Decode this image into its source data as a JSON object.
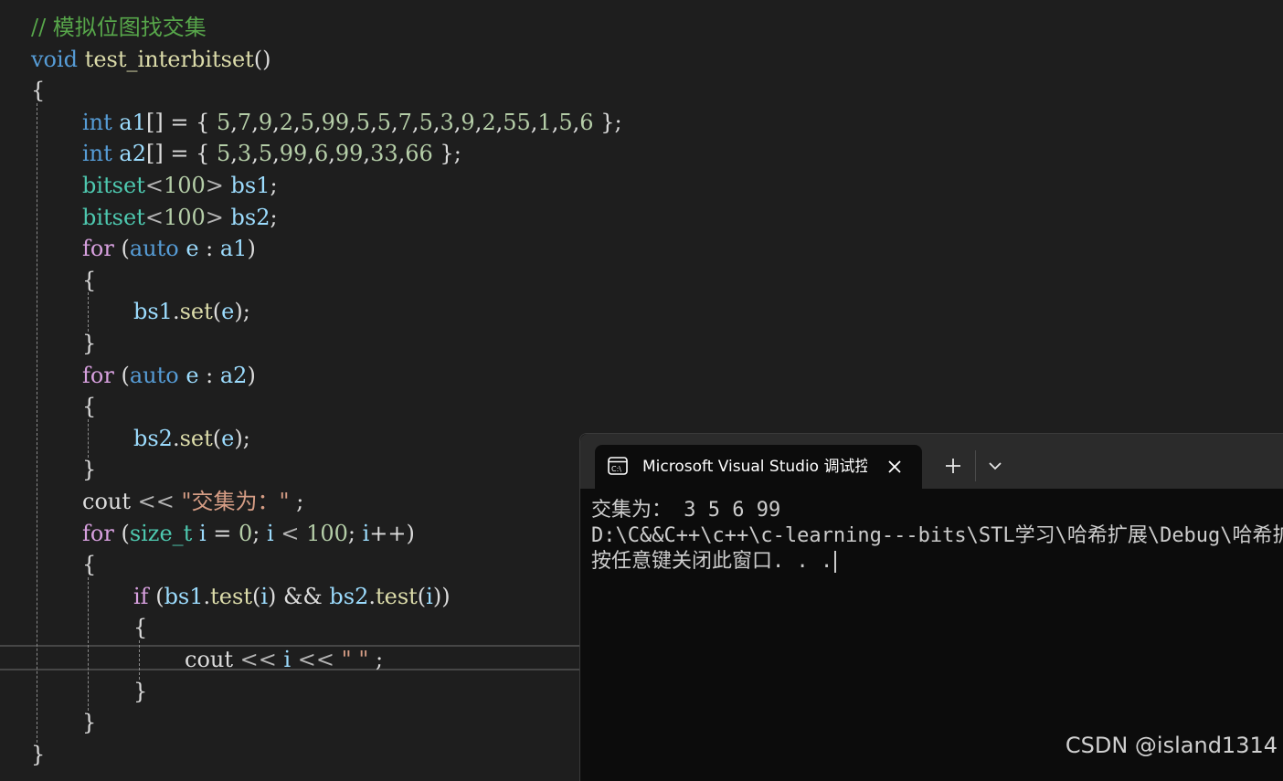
{
  "editor": {
    "lines": [
      [
        {
          "t": "// 模拟位图找交集",
          "c": "cmt"
        }
      ],
      [
        {
          "t": "void",
          "c": "kw"
        },
        {
          "t": " ",
          "c": "punc"
        },
        {
          "t": "test_interbitset",
          "c": "fn"
        },
        {
          "t": "()",
          "c": "punc"
        }
      ],
      [
        {
          "t": "{",
          "c": "punc"
        }
      ],
      [
        {
          "t": "int",
          "c": "kw"
        },
        {
          "t": " ",
          "c": "punc"
        },
        {
          "t": "a1",
          "c": "id"
        },
        {
          "t": "[] = { ",
          "c": "punc"
        },
        {
          "t": "5",
          "c": "num"
        },
        {
          "t": ",",
          "c": "punc"
        },
        {
          "t": "7",
          "c": "num"
        },
        {
          "t": ",",
          "c": "punc"
        },
        {
          "t": "9",
          "c": "num"
        },
        {
          "t": ",",
          "c": "punc"
        },
        {
          "t": "2",
          "c": "num"
        },
        {
          "t": ",",
          "c": "punc"
        },
        {
          "t": "5",
          "c": "num"
        },
        {
          "t": ",",
          "c": "punc"
        },
        {
          "t": "99",
          "c": "num"
        },
        {
          "t": ",",
          "c": "punc"
        },
        {
          "t": "5",
          "c": "num"
        },
        {
          "t": ",",
          "c": "punc"
        },
        {
          "t": "5",
          "c": "num"
        },
        {
          "t": ",",
          "c": "punc"
        },
        {
          "t": "7",
          "c": "num"
        },
        {
          "t": ",",
          "c": "punc"
        },
        {
          "t": "5",
          "c": "num"
        },
        {
          "t": ",",
          "c": "punc"
        },
        {
          "t": "3",
          "c": "num"
        },
        {
          "t": ",",
          "c": "punc"
        },
        {
          "t": "9",
          "c": "num"
        },
        {
          "t": ",",
          "c": "punc"
        },
        {
          "t": "2",
          "c": "num"
        },
        {
          "t": ",",
          "c": "punc"
        },
        {
          "t": "55",
          "c": "num"
        },
        {
          "t": ",",
          "c": "punc"
        },
        {
          "t": "1",
          "c": "num"
        },
        {
          "t": ",",
          "c": "punc"
        },
        {
          "t": "5",
          "c": "num"
        },
        {
          "t": ",",
          "c": "punc"
        },
        {
          "t": "6",
          "c": "num"
        },
        {
          "t": " };",
          "c": "punc"
        }
      ],
      [
        {
          "t": "int",
          "c": "kw"
        },
        {
          "t": " ",
          "c": "punc"
        },
        {
          "t": "a2",
          "c": "id"
        },
        {
          "t": "[] = { ",
          "c": "punc"
        },
        {
          "t": "5",
          "c": "num"
        },
        {
          "t": ",",
          "c": "punc"
        },
        {
          "t": "3",
          "c": "num"
        },
        {
          "t": ",",
          "c": "punc"
        },
        {
          "t": "5",
          "c": "num"
        },
        {
          "t": ",",
          "c": "punc"
        },
        {
          "t": "99",
          "c": "num"
        },
        {
          "t": ",",
          "c": "punc"
        },
        {
          "t": "6",
          "c": "num"
        },
        {
          "t": ",",
          "c": "punc"
        },
        {
          "t": "99",
          "c": "num"
        },
        {
          "t": ",",
          "c": "punc"
        },
        {
          "t": "33",
          "c": "num"
        },
        {
          "t": ",",
          "c": "punc"
        },
        {
          "t": "66",
          "c": "num"
        },
        {
          "t": " };",
          "c": "punc"
        }
      ],
      [
        {
          "t": "bitset",
          "c": "type"
        },
        {
          "t": "<",
          "c": "op"
        },
        {
          "t": "100",
          "c": "num"
        },
        {
          "t": ">",
          "c": "op"
        },
        {
          "t": " ",
          "c": "punc"
        },
        {
          "t": "bs1",
          "c": "id"
        },
        {
          "t": ";",
          "c": "punc"
        }
      ],
      [
        {
          "t": "bitset",
          "c": "type"
        },
        {
          "t": "<",
          "c": "op"
        },
        {
          "t": "100",
          "c": "num"
        },
        {
          "t": ">",
          "c": "op"
        },
        {
          "t": " ",
          "c": "punc"
        },
        {
          "t": "bs2",
          "c": "id"
        },
        {
          "t": ";",
          "c": "punc"
        }
      ],
      [
        {
          "t": "for",
          "c": "ctrl"
        },
        {
          "t": " (",
          "c": "punc"
        },
        {
          "t": "auto",
          "c": "kw"
        },
        {
          "t": " ",
          "c": "punc"
        },
        {
          "t": "e",
          "c": "id"
        },
        {
          "t": " : ",
          "c": "punc"
        },
        {
          "t": "a1",
          "c": "id"
        },
        {
          "t": ")",
          "c": "punc"
        }
      ],
      [
        {
          "t": "{",
          "c": "punc"
        }
      ],
      [
        {
          "t": "bs1",
          "c": "id"
        },
        {
          "t": ".",
          "c": "punc"
        },
        {
          "t": "set",
          "c": "fn"
        },
        {
          "t": "(",
          "c": "punc"
        },
        {
          "t": "e",
          "c": "id"
        },
        {
          "t": ");",
          "c": "punc"
        }
      ],
      [
        {
          "t": "}",
          "c": "punc"
        }
      ],
      [
        {
          "t": "for",
          "c": "ctrl"
        },
        {
          "t": " (",
          "c": "punc"
        },
        {
          "t": "auto",
          "c": "kw"
        },
        {
          "t": " ",
          "c": "punc"
        },
        {
          "t": "e",
          "c": "id"
        },
        {
          "t": " : ",
          "c": "punc"
        },
        {
          "t": "a2",
          "c": "id"
        },
        {
          "t": ")",
          "c": "punc"
        }
      ],
      [
        {
          "t": "{",
          "c": "punc"
        }
      ],
      [
        {
          "t": "bs2",
          "c": "id"
        },
        {
          "t": ".",
          "c": "punc"
        },
        {
          "t": "set",
          "c": "fn"
        },
        {
          "t": "(",
          "c": "punc"
        },
        {
          "t": "e",
          "c": "id"
        },
        {
          "t": ");",
          "c": "punc"
        }
      ],
      [
        {
          "t": "}",
          "c": "punc"
        }
      ],
      [
        {
          "t": "cout",
          "c": "punc"
        },
        {
          "t": " << ",
          "c": "op"
        },
        {
          "t": "\"交集为：\"",
          "c": "str"
        },
        {
          "t": " ;",
          "c": "punc"
        }
      ],
      [
        {
          "t": "for",
          "c": "ctrl"
        },
        {
          "t": " (",
          "c": "punc"
        },
        {
          "t": "size_t",
          "c": "type"
        },
        {
          "t": " ",
          "c": "punc"
        },
        {
          "t": "i",
          "c": "id"
        },
        {
          "t": " = ",
          "c": "punc"
        },
        {
          "t": "0",
          "c": "num"
        },
        {
          "t": "; ",
          "c": "punc"
        },
        {
          "t": "i",
          "c": "id"
        },
        {
          "t": " < ",
          "c": "op"
        },
        {
          "t": "100",
          "c": "num"
        },
        {
          "t": "; ",
          "c": "punc"
        },
        {
          "t": "i",
          "c": "id"
        },
        {
          "t": "++)",
          "c": "punc"
        }
      ],
      [
        {
          "t": "{",
          "c": "punc"
        }
      ],
      [
        {
          "t": "if",
          "c": "ctrl"
        },
        {
          "t": " (",
          "c": "punc"
        },
        {
          "t": "bs1",
          "c": "id"
        },
        {
          "t": ".",
          "c": "punc"
        },
        {
          "t": "test",
          "c": "fn"
        },
        {
          "t": "(",
          "c": "punc"
        },
        {
          "t": "i",
          "c": "id"
        },
        {
          "t": ") && ",
          "c": "punc"
        },
        {
          "t": "bs2",
          "c": "id"
        },
        {
          "t": ".",
          "c": "punc"
        },
        {
          "t": "test",
          "c": "fn"
        },
        {
          "t": "(",
          "c": "punc"
        },
        {
          "t": "i",
          "c": "id"
        },
        {
          "t": "))",
          "c": "punc"
        }
      ],
      [
        {
          "t": "{",
          "c": "punc"
        }
      ],
      [
        {
          "t": "cout",
          "c": "punc"
        },
        {
          "t": " << ",
          "c": "op"
        },
        {
          "t": "i",
          "c": "id"
        },
        {
          "t": " << ",
          "c": "op"
        },
        {
          "t": "\" \"",
          "c": "str"
        },
        {
          "t": " ;",
          "c": "punc"
        }
      ],
      [
        {
          "t": "}",
          "c": "punc"
        }
      ],
      [
        {
          "t": "}",
          "c": "punc"
        }
      ],
      [
        {
          "t": "}",
          "c": "punc"
        }
      ]
    ],
    "indents": [
      0,
      0,
      0,
      1,
      1,
      1,
      1,
      1,
      1,
      2,
      1,
      1,
      1,
      2,
      1,
      1,
      1,
      1,
      2,
      2,
      3,
      2,
      1,
      0
    ]
  },
  "terminal": {
    "tab_title": "Microsoft Visual Studio 调试控制台",
    "tab_icon": "console-icon",
    "close_icon": "close-icon",
    "new_tab_icon": "plus-icon",
    "dropdown_icon": "chevron-down-icon",
    "output": [
      "交集为： 3 5 6 99",
      "D:\\C&&C++\\c++\\c-learning---bits\\STL学习\\哈希扩展\\Debug\\哈希扩展.exe",
      "按任意键关闭此窗口. . ."
    ]
  },
  "watermark": "CSDN @island1314",
  "colors": {
    "background": "#1e1e1e",
    "keyword": "#569cd6",
    "type": "#4ec9b0",
    "identifier": "#9cdcfe",
    "function": "#dcdcaa",
    "number": "#b5cea8",
    "string": "#d69d85",
    "comment": "#57a64a",
    "control": "#d8a0df",
    "terminal_bg": "#0c0c0c"
  }
}
